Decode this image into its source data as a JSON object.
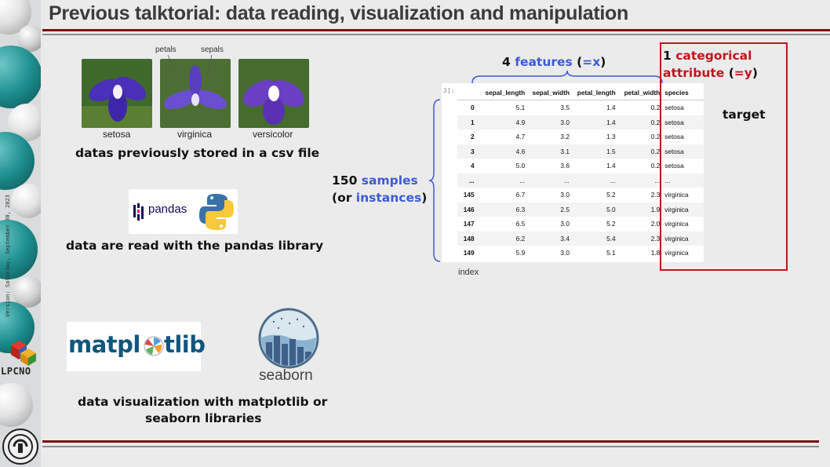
{
  "slide": {
    "title": "Previous talktorial: data reading, visualization and manipulation",
    "version": "Version: Saturday, September 30, 2023",
    "lab_logo": "LPCNO"
  },
  "flowers": {
    "petals_label": "petals",
    "sepals_label": "sepals",
    "captions": [
      "setosa",
      "virginica",
      "versicolor"
    ]
  },
  "texts": {
    "csv_line": "datas previously stored in a csv file",
    "pandas_line": "data are read with the pandas library",
    "viz_line1": "data visualization with matplotlib or",
    "viz_line2": "seaborn libraries"
  },
  "logos": {
    "pandas": "pandas",
    "matplotlib_a": "matpl",
    "matplotlib_b": "tlib",
    "seaborn": "seaborn"
  },
  "dataframe": {
    "prompt": "3]:",
    "columns": [
      "",
      "sepal_length",
      "sepal_width",
      "petal_length",
      "petal_width",
      "species"
    ],
    "rows": [
      [
        "0",
        "5.1",
        "3.5",
        "1.4",
        "0.2",
        "setosa"
      ],
      [
        "1",
        "4.9",
        "3.0",
        "1.4",
        "0.2",
        "setosa"
      ],
      [
        "2",
        "4.7",
        "3.2",
        "1.3",
        "0.2",
        "setosa"
      ],
      [
        "3",
        "4.6",
        "3.1",
        "1.5",
        "0.2",
        "setosa"
      ],
      [
        "4",
        "5.0",
        "3.6",
        "1.4",
        "0.2",
        "setosa"
      ],
      [
        "...",
        "...",
        "...",
        "...",
        "...",
        "..."
      ],
      [
        "145",
        "6.7",
        "3.0",
        "5.2",
        "2.3",
        "virginica"
      ],
      [
        "146",
        "6.3",
        "2.5",
        "5.0",
        "1.9",
        "virginica"
      ],
      [
        "147",
        "6.5",
        "3.0",
        "5.2",
        "2.0",
        "virginica"
      ],
      [
        "148",
        "6.2",
        "3.4",
        "5.4",
        "2.3",
        "virginica"
      ],
      [
        "149",
        "5.9",
        "3.0",
        "5.1",
        "1.8",
        "virginica"
      ]
    ],
    "index_label": "index"
  },
  "annotations": {
    "features_count": "4",
    "features_word": "features",
    "features_open": "(",
    "features_eq": "=x",
    "features_close": ")",
    "samples_count": "150",
    "samples_word": "samples",
    "instances_open": "(or",
    "instances_word": "instances",
    "instances_close": ")",
    "cat_count": "1",
    "cat_word": "categorical",
    "attribute_word": "attribute",
    "attr_open": "(",
    "attr_eq": "=y",
    "attr_close": ")",
    "target": "target"
  },
  "colors": {
    "accent_blue": "#3d5bd6",
    "accent_red": "#c0151b",
    "bar_red": "#7a0b0b"
  }
}
